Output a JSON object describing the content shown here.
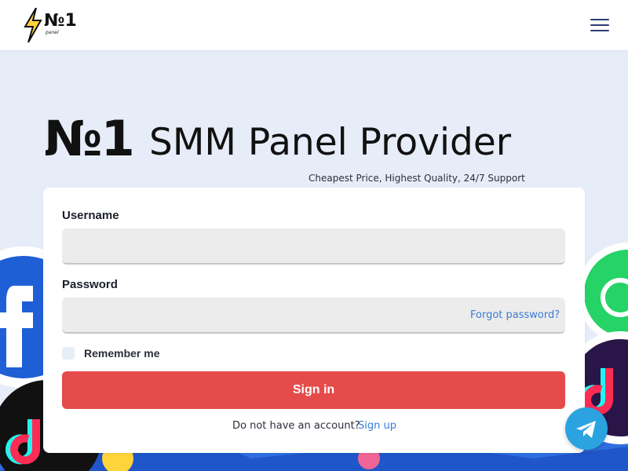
{
  "header": {
    "logo_text": "№1",
    "logo_sub": "panel",
    "menu_icon": "hamburger-icon"
  },
  "hero": {
    "mark": "№1",
    "title": "SMM Panel Provider",
    "tagline": "Cheapest Price, Highest Quality, 24/7 Support"
  },
  "login": {
    "username_label": "Username",
    "username_value": "",
    "password_label": "Password",
    "password_value": "",
    "forgot_label": "Forgot password?",
    "remember_label": "Remember me",
    "remember_checked": false,
    "signin_label": "Sign in",
    "no_account_text": "Do not have an account?",
    "signup_label": "Sign up"
  },
  "floating": {
    "telegram_icon": "telegram-icon"
  },
  "colors": {
    "page_bg": "#e7edf8",
    "primary_button": "#e54b4b",
    "link": "#3a7bd5",
    "telegram": "#2aa3e0"
  }
}
